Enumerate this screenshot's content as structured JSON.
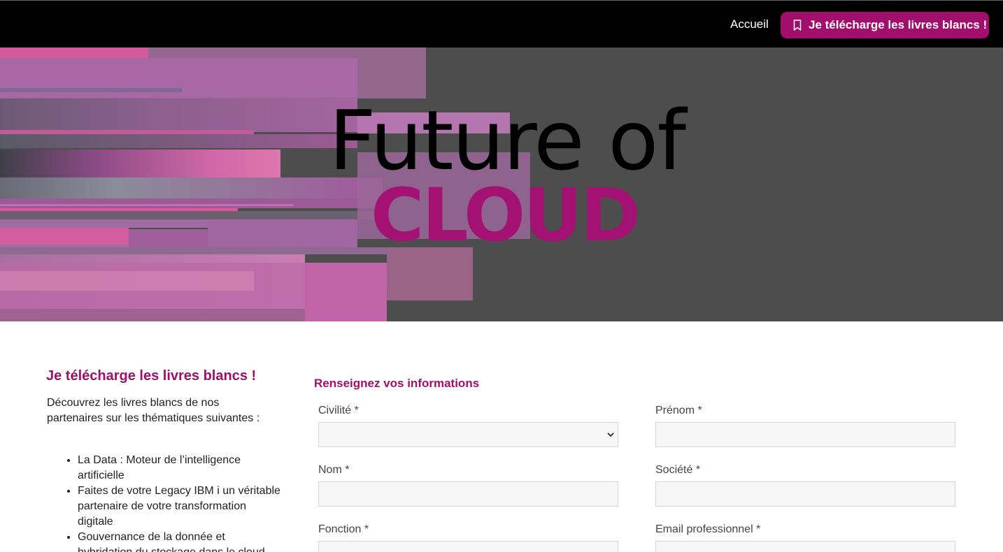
{
  "nav": {
    "home": "Accueil",
    "cta": "Je télécharge les livres blancs !"
  },
  "hero": {
    "line1": "Future of",
    "line2": "CLOUD"
  },
  "sidebar": {
    "title": "Je télécharge les livres blancs !",
    "intro": "Découvrez les livres blancs de nos partenaires sur les thématiques suivantes :",
    "items": [
      "La Data : Moteur de l’intelligence artificielle",
      "Faites de votre Legacy IBM i un véritable partenaire de votre transformation digitale",
      "Gouvernance de la donnée et hybridation du stockage dans le cloud"
    ]
  },
  "form": {
    "title": "Renseignez vos informations",
    "fields": {
      "civilite": "Civilité *",
      "prenom": "Prénom *",
      "nom": "Nom *",
      "societe": "Société *",
      "fonction": "Fonction *",
      "email": "Email professionnel *"
    }
  },
  "colors": {
    "accent": "#a10e6c",
    "hero_bg": "#4d4d4d",
    "nav_bg": "#000000"
  }
}
